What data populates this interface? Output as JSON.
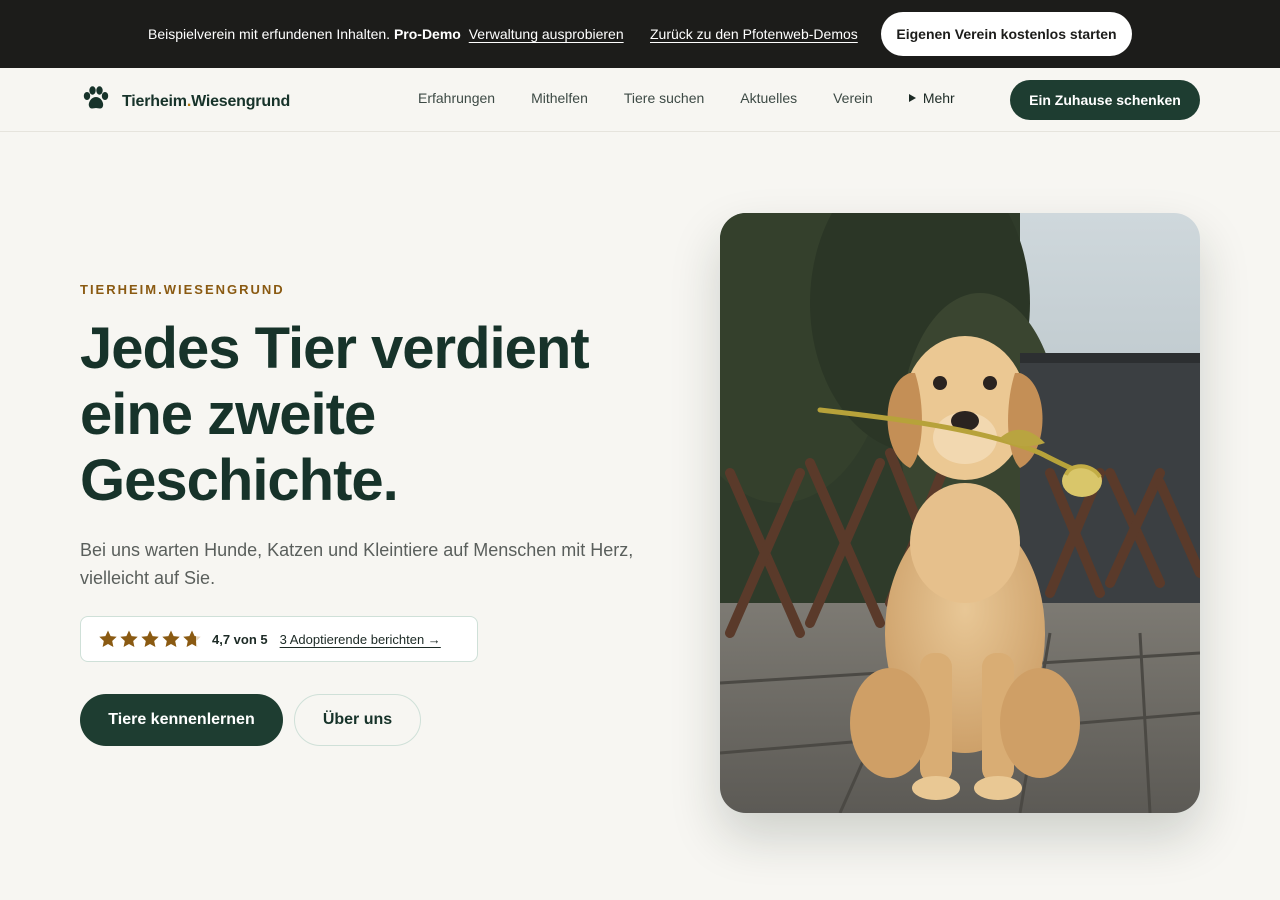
{
  "banner": {
    "text": "Beispielverein mit erfundenen Inhalten.",
    "badge": "Pro-Demo",
    "admin_link": "Verwaltung ausprobieren",
    "back_link": "Zurück zu den Pfotenweb-Demos",
    "cta": "Eigenen Verein kostenlos starten"
  },
  "nav": {
    "brand_first": "Tierheim",
    "brand_dot": ".",
    "brand_second": "Wiesengrund",
    "links": [
      "Erfahrungen",
      "Mithelfen",
      "Tiere suchen",
      "Aktuelles",
      "Verein"
    ],
    "more": "Mehr",
    "cta": "Ein Zuhause schenken"
  },
  "hero": {
    "eyebrow": "TIERHEIM.WIESENGRUND",
    "title": "Jedes Tier verdient eine zweite Geschichte.",
    "subtitle": "Bei uns warten Hunde, Katzen und Kleintiere auf Menschen mit Herz, vielleicht auf Sie.",
    "rating": {
      "score": 4.7,
      "max": 5,
      "label": "4,7 von 5",
      "link": "3 Adoptierende berichten →"
    },
    "primary_button": "Tiere kennenlernen",
    "secondary_button": "Über uns"
  },
  "colors": {
    "accent": "#1e3d31",
    "gold": "#8a5a12",
    "banner_bg": "#1c1c1a",
    "page_bg": "#f7f6f2"
  },
  "icons": {
    "logo": "paw-icon",
    "more": "triangle-right-icon",
    "rating": "star-icon"
  }
}
